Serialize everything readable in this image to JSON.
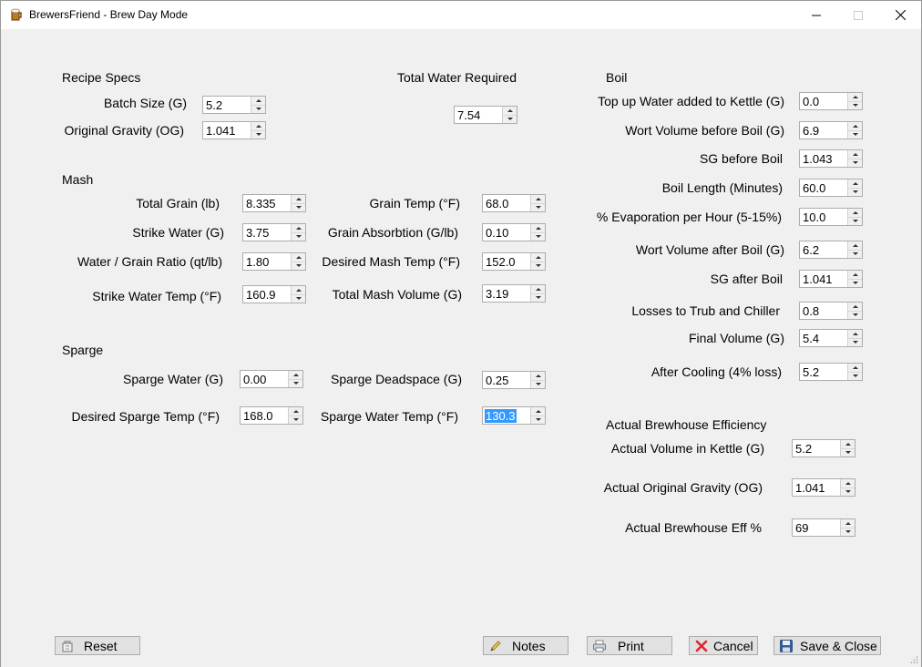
{
  "window": {
    "title": "BrewersFriend - Brew Day Mode"
  },
  "recipe": {
    "title": "Recipe Specs",
    "batch_size_label": "Batch Size (G)",
    "batch_size": "5.2",
    "og_label": "Original Gravity (OG)",
    "og": "1.041"
  },
  "total_water": {
    "title": "Total Water Required",
    "value": "7.54"
  },
  "mash": {
    "title": "Mash",
    "total_grain_label": "Total Grain (lb)",
    "total_grain": "8.335",
    "strike_water_label": "Strike Water (G)",
    "strike_water": "3.75",
    "ratio_label": "Water / Grain Ratio (qt/lb)",
    "ratio": "1.80",
    "strike_temp_label": "Strike Water Temp (°F)",
    "strike_temp": "160.9",
    "grain_temp_label": "Grain Temp (°F)",
    "grain_temp": "68.0",
    "absorption_label": "Grain Absorbtion (G/lb)",
    "absorption": "0.10",
    "desired_mash_temp_label": "Desired Mash Temp (°F)",
    "desired_mash_temp": "152.0",
    "total_mash_volume_label": "Total Mash Volume (G)",
    "total_mash_volume": "3.19"
  },
  "sparge": {
    "title": "Sparge",
    "sparge_water_label": "Sparge Water (G)",
    "sparge_water": "0.00",
    "desired_temp_label": "Desired Sparge Temp (°F)",
    "desired_temp": "168.0",
    "deadspace_label": "Sparge Deadspace (G)",
    "deadspace": "0.25",
    "water_temp_label": "Sparge Water Temp (°F)",
    "water_temp": "130.3"
  },
  "boil": {
    "title": "Boil",
    "topup_label": "Top up Water added to Kettle (G)",
    "topup": "0.0",
    "wort_before_label": "Wort Volume before Boil (G)",
    "wort_before": "6.9",
    "sg_before_label": "SG before Boil",
    "sg_before": "1.043",
    "length_label": "Boil Length (Minutes)",
    "length": "60.0",
    "evap_label": "% Evaporation per Hour (5-15%)",
    "evap": "10.0",
    "wort_after_label": "Wort Volume after Boil (G)",
    "wort_after": "6.2",
    "sg_after_label": "SG after Boil",
    "sg_after": "1.041",
    "losses_label": "Losses to Trub and Chiller",
    "losses": "0.8",
    "final_label": "Final Volume (G)",
    "final": "5.4",
    "cooling_label": "After Cooling (4% loss)",
    "cooling": "5.2"
  },
  "efficiency": {
    "title": "Actual Brewhouse Efficiency",
    "volume_label": "Actual Volume in Kettle (G)",
    "volume": "5.2",
    "og_label": "Actual Original Gravity (OG)",
    "og": "1.041",
    "eff_label": "Actual Brewhouse Eff %",
    "eff": "69"
  },
  "buttons": {
    "reset": "Reset",
    "notes": "Notes",
    "print": "Print",
    "cancel": "Cancel",
    "save_close": "Save & Close"
  }
}
